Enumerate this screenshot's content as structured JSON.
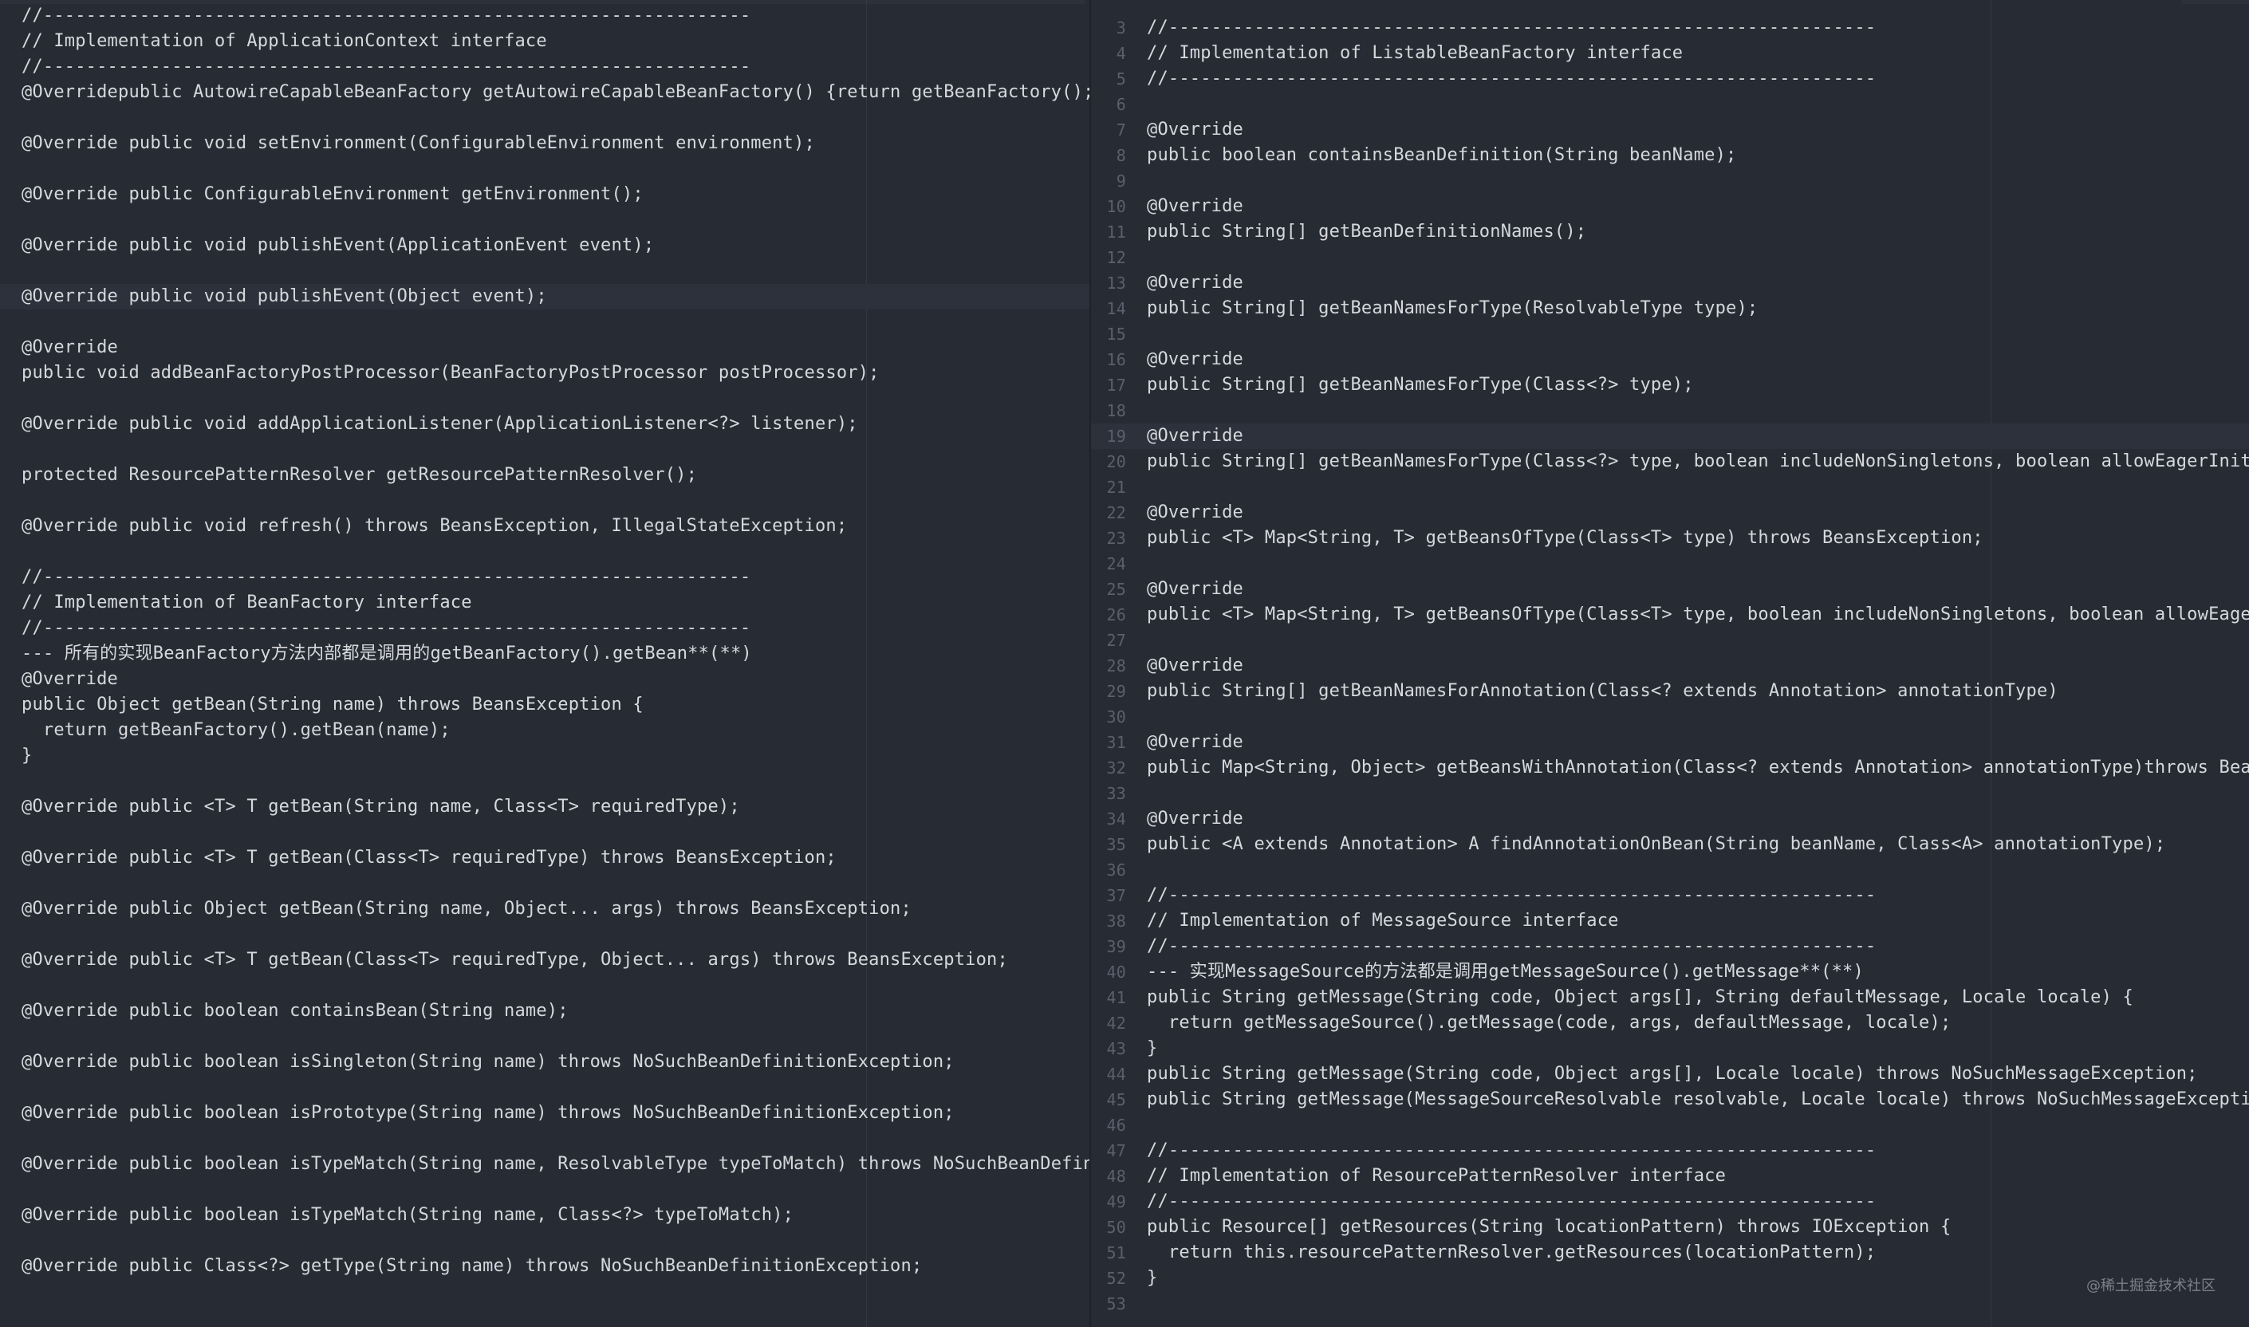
{
  "left_pane": {
    "lines": [
      "//------------------------------------------------------------------",
      "// Implementation of ApplicationContext interface",
      "//------------------------------------------------------------------",
      "@Overridepublic AutowireCapableBeanFactory getAutowireCapableBeanFactory() {return getBeanFactory();}",
      "",
      "@Override public void setEnvironment(ConfigurableEnvironment environment);",
      "",
      "@Override public ConfigurableEnvironment getEnvironment();",
      "",
      "@Override public void publishEvent(ApplicationEvent event);",
      "",
      "@Override public void publishEvent(Object event);",
      "",
      "@Override",
      "public void addBeanFactoryPostProcessor(BeanFactoryPostProcessor postProcessor);",
      "",
      "@Override public void addApplicationListener(ApplicationListener<?> listener);",
      "",
      "protected ResourcePatternResolver getResourcePatternResolver();",
      "",
      "@Override public void refresh() throws BeansException, IllegalStateException;",
      "",
      "//------------------------------------------------------------------",
      "// Implementation of BeanFactory interface",
      "//------------------------------------------------------------------",
      "--- 所有的实现BeanFactory方法内部都是调用的getBeanFactory().getBean**(**)",
      "@Override",
      "public Object getBean(String name) throws BeansException {",
      "  return getBeanFactory().getBean(name);",
      "}",
      "",
      "@Override public <T> T getBean(String name, Class<T> requiredType);",
      "",
      "@Override public <T> T getBean(Class<T> requiredType) throws BeansException;",
      "",
      "@Override public Object getBean(String name, Object... args) throws BeansException;",
      "",
      "@Override public <T> T getBean(Class<T> requiredType, Object... args) throws BeansException;",
      "",
      "@Override public boolean containsBean(String name);",
      "",
      "@Override public boolean isSingleton(String name) throws NoSuchBeanDefinitionException;",
      "",
      "@Override public boolean isPrototype(String name) throws NoSuchBeanDefinitionException;",
      "",
      "@Override public boolean isTypeMatch(String name, ResolvableType typeToMatch) throws NoSuchBeanDefini",
      "",
      "@Override public boolean isTypeMatch(String name, Class<?> typeToMatch);",
      "",
      "@Override public Class<?> getType(String name) throws NoSuchBeanDefinitionException;"
    ]
  },
  "right_pane": {
    "lines": [
      {
        "n": "3",
        "t": "//------------------------------------------------------------------"
      },
      {
        "n": "4",
        "t": "// Implementation of ListableBeanFactory interface"
      },
      {
        "n": "5",
        "t": "//------------------------------------------------------------------"
      },
      {
        "n": "6",
        "t": ""
      },
      {
        "n": "7",
        "t": "@Override"
      },
      {
        "n": "8",
        "t": "public boolean containsBeanDefinition(String beanName);"
      },
      {
        "n": "9",
        "t": ""
      },
      {
        "n": "10",
        "t": "@Override"
      },
      {
        "n": "11",
        "t": "public String[] getBeanDefinitionNames();"
      },
      {
        "n": "12",
        "t": ""
      },
      {
        "n": "13",
        "t": "@Override"
      },
      {
        "n": "14",
        "t": "public String[] getBeanNamesForType(ResolvableType type);"
      },
      {
        "n": "15",
        "t": ""
      },
      {
        "n": "16",
        "t": "@Override"
      },
      {
        "n": "17",
        "t": "public String[] getBeanNamesForType(Class<?> type);"
      },
      {
        "n": "18",
        "t": ""
      },
      {
        "n": "19",
        "t": "@Override"
      },
      {
        "n": "20",
        "t": "public String[] getBeanNamesForType(Class<?> type, boolean includeNonSingletons, boolean allowEagerInit)"
      },
      {
        "n": "21",
        "t": ""
      },
      {
        "n": "22",
        "t": "@Override"
      },
      {
        "n": "23",
        "t": "public <T> Map<String, T> getBeansOfType(Class<T> type) throws BeansException;"
      },
      {
        "n": "24",
        "t": ""
      },
      {
        "n": "25",
        "t": "@Override"
      },
      {
        "n": "26",
        "t": "public <T> Map<String, T> getBeansOfType(Class<T> type, boolean includeNonSingletons, boolean allowEager"
      },
      {
        "n": "27",
        "t": ""
      },
      {
        "n": "28",
        "t": "@Override"
      },
      {
        "n": "29",
        "t": "public String[] getBeanNamesForAnnotation(Class<? extends Annotation> annotationType)"
      },
      {
        "n": "30",
        "t": ""
      },
      {
        "n": "31",
        "t": "@Override"
      },
      {
        "n": "32",
        "t": "public Map<String, Object> getBeansWithAnnotation(Class<? extends Annotation> annotationType)throws Bean"
      },
      {
        "n": "33",
        "t": ""
      },
      {
        "n": "34",
        "t": "@Override"
      },
      {
        "n": "35",
        "t": "public <A extends Annotation> A findAnnotationOnBean(String beanName, Class<A> annotationType);"
      },
      {
        "n": "36",
        "t": ""
      },
      {
        "n": "37",
        "t": "//------------------------------------------------------------------"
      },
      {
        "n": "38",
        "t": "// Implementation of MessageSource interface"
      },
      {
        "n": "39",
        "t": "//------------------------------------------------------------------"
      },
      {
        "n": "40",
        "t": "--- 实现MessageSource的方法都是调用getMessageSource().getMessage**(**)"
      },
      {
        "n": "41",
        "t": "public String getMessage(String code, Object args[], String defaultMessage, Locale locale) {"
      },
      {
        "n": "42",
        "t": "  return getMessageSource().getMessage(code, args, defaultMessage, locale);"
      },
      {
        "n": "43",
        "t": "}"
      },
      {
        "n": "44",
        "t": "public String getMessage(String code, Object args[], Locale locale) throws NoSuchMessageException;"
      },
      {
        "n": "45",
        "t": "public String getMessage(MessageSourceResolvable resolvable, Locale locale) throws NoSuchMessageExceptio"
      },
      {
        "n": "46",
        "t": ""
      },
      {
        "n": "47",
        "t": "//------------------------------------------------------------------"
      },
      {
        "n": "48",
        "t": "// Implementation of ResourcePatternResolver interface"
      },
      {
        "n": "49",
        "t": "//------------------------------------------------------------------"
      },
      {
        "n": "50",
        "t": "public Resource[] getResources(String locationPattern) throws IOException {"
      },
      {
        "n": "51",
        "t": "  return this.resourcePatternResolver.getResources(locationPattern);"
      },
      {
        "n": "52",
        "t": "}"
      },
      {
        "n": "53",
        "t": ""
      }
    ]
  },
  "watermark": "@稀土掘金技术社区"
}
